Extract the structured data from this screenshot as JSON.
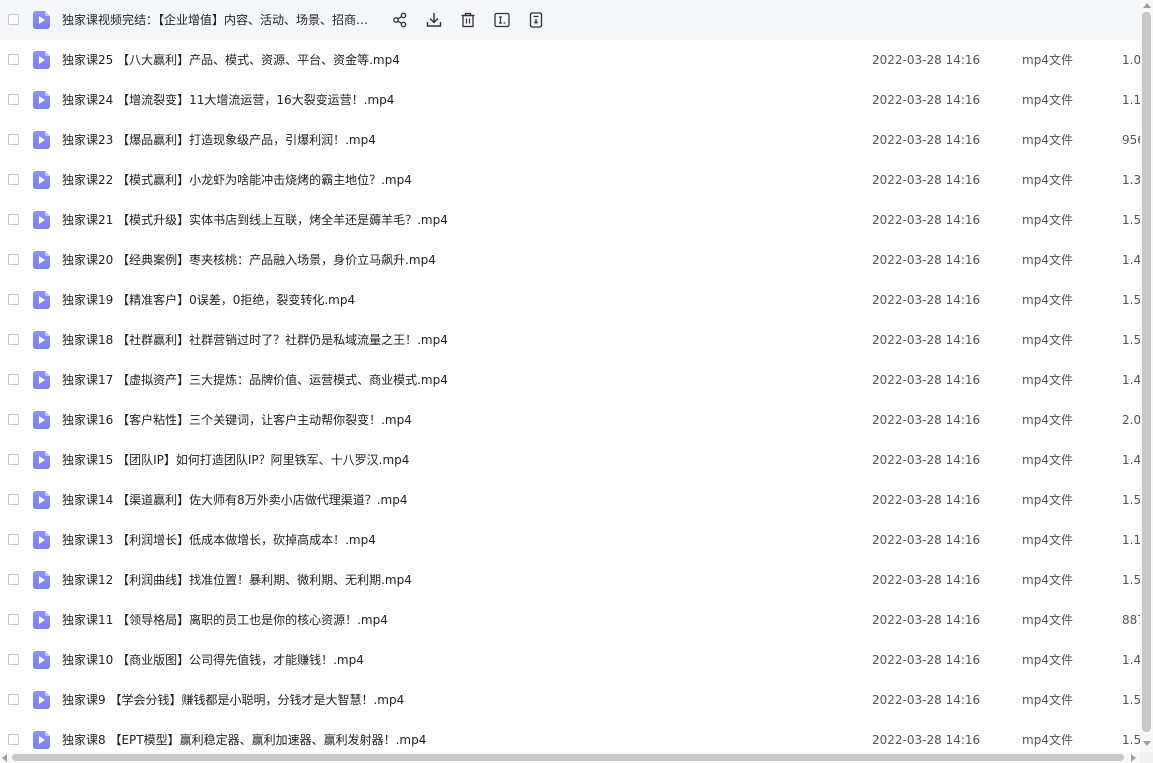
{
  "hovered_row": {
    "name": "独家课视频完结：【企业增值】内容、活动、场景、招商…",
    "actions": [
      {
        "name": "share-icon"
      },
      {
        "name": "download-icon"
      },
      {
        "name": "delete-icon"
      },
      {
        "name": "rename-icon"
      },
      {
        "name": "more-icon"
      }
    ]
  },
  "files": [
    {
      "name": "独家课25 【八大赢利】产品、模式、资源、平台、资金等.mp4",
      "date": "2022-03-28 14:16",
      "type": "mp4文件",
      "size": "1.0"
    },
    {
      "name": "独家课24 【增流裂变】11大增流运营，16大裂变运营！.mp4",
      "date": "2022-03-28 14:16",
      "type": "mp4文件",
      "size": "1.1"
    },
    {
      "name": "独家课23 【爆品赢利】打造现象级产品，引爆利润！.mp4",
      "date": "2022-03-28 14:16",
      "type": "mp4文件",
      "size": "956"
    },
    {
      "name": "独家课22 【模式赢利】小龙虾为啥能冲击烧烤的霸主地位？.mp4",
      "date": "2022-03-28 14:16",
      "type": "mp4文件",
      "size": "1.3"
    },
    {
      "name": "独家课21 【模式升级】实体书店到线上互联，烤全羊还是薅羊毛？.mp4",
      "date": "2022-03-28 14:16",
      "type": "mp4文件",
      "size": "1.5"
    },
    {
      "name": "独家课20 【经典案例】枣夹核桃：产品融入场景，身价立马飙升.mp4",
      "date": "2022-03-28 14:16",
      "type": "mp4文件",
      "size": "1.4"
    },
    {
      "name": "独家课19 【精准客户】0误差，0拒绝，裂变转化.mp4",
      "date": "2022-03-28 14:16",
      "type": "mp4文件",
      "size": "1.5"
    },
    {
      "name": "独家课18 【社群赢利】社群营销过时了？社群仍是私域流量之王！.mp4",
      "date": "2022-03-28 14:16",
      "type": "mp4文件",
      "size": "1.5"
    },
    {
      "name": "独家课17 【虚拟资产】三大提炼：品牌价值、运营模式、商业模式.mp4",
      "date": "2022-03-28 14:16",
      "type": "mp4文件",
      "size": "1.4"
    },
    {
      "name": "独家课16 【客户粘性】三个关键词，让客户主动帮你裂变！.mp4",
      "date": "2022-03-28 14:16",
      "type": "mp4文件",
      "size": "2.0"
    },
    {
      "name": "独家课15 【团队IP】如何打造团队IP？阿里铁军、十八罗汉.mp4",
      "date": "2022-03-28 14:16",
      "type": "mp4文件",
      "size": "1.4"
    },
    {
      "name": "独家课14 【渠道赢利】佐大师有8万外卖小店做代理渠道？.mp4",
      "date": "2022-03-28 14:16",
      "type": "mp4文件",
      "size": "1.5"
    },
    {
      "name": "独家课13 【利润增长】低成本做增长，砍掉高成本！.mp4",
      "date": "2022-03-28 14:16",
      "type": "mp4文件",
      "size": "1.1"
    },
    {
      "name": "独家课12 【利润曲线】找准位置！暴利期、微利期、无利期.mp4",
      "date": "2022-03-28 14:16",
      "type": "mp4文件",
      "size": "1.5"
    },
    {
      "name": "独家课11 【领导格局】离职的员工也是你的核心资源！.mp4",
      "date": "2022-03-28 14:16",
      "type": "mp4文件",
      "size": "887"
    },
    {
      "name": "独家课10 【商业版图】公司得先值钱，才能赚钱！.mp4",
      "date": "2022-03-28 14:16",
      "type": "mp4文件",
      "size": "1.4"
    },
    {
      "name": "独家课9 【学会分钱】赚钱都是小聪明，分钱才是大智慧！.mp4",
      "date": "2022-03-28 14:16",
      "type": "mp4文件",
      "size": "1.5"
    },
    {
      "name": "独家课8 【EPT模型】赢利稳定器、赢利加速器、赢利发射器！.mp4",
      "date": "2022-03-28 14:16",
      "type": "mp4文件",
      "size": "1.5"
    }
  ]
}
